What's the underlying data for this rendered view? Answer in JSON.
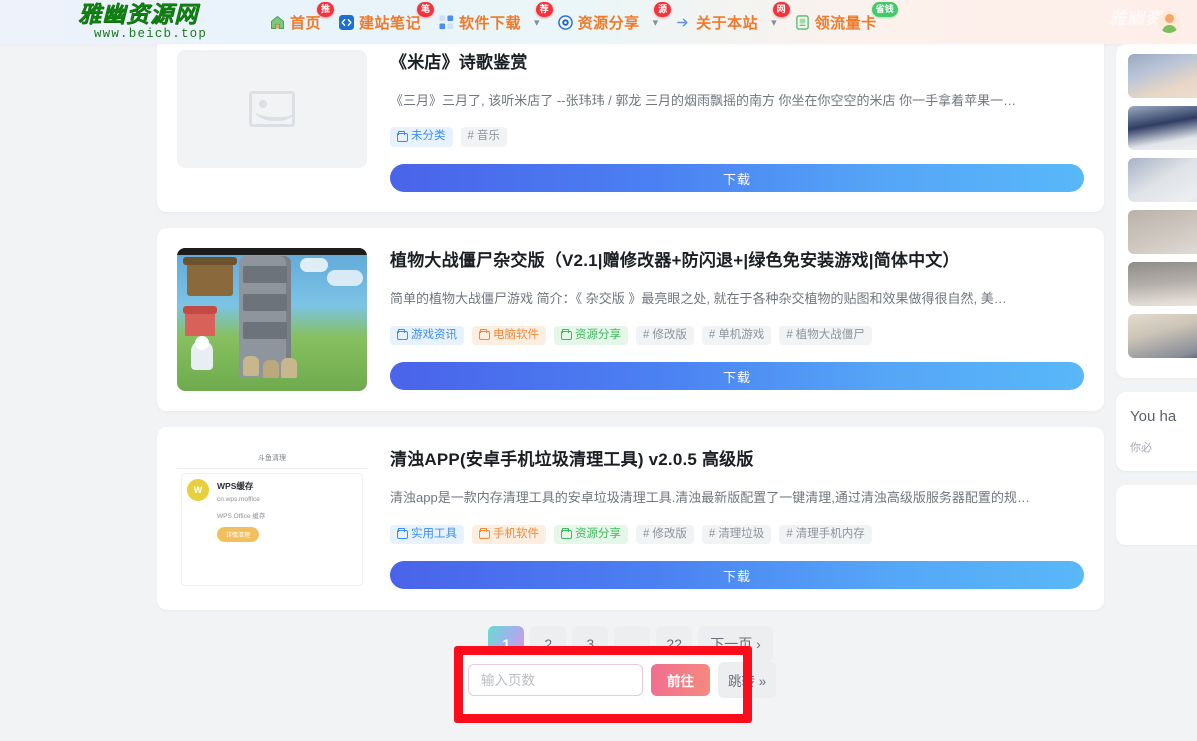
{
  "site": {
    "logo_cn": "雅幽资源网",
    "logo_url": "www.beicb.top"
  },
  "nav": {
    "items": [
      {
        "label": "首页",
        "icon": "home-icon",
        "badge": "推",
        "badge_color": "red",
        "has_caret": false
      },
      {
        "label": "建站笔记",
        "icon": "code-icon",
        "badge": "笔",
        "badge_color": "red",
        "has_caret": false
      },
      {
        "label": "软件下载",
        "icon": "apps-icon",
        "badge": "荐",
        "badge_color": "red",
        "has_caret": true
      },
      {
        "label": "资源分享",
        "icon": "target-icon",
        "badge": "源",
        "badge_color": "red",
        "has_caret": true
      },
      {
        "label": "关于本站",
        "icon": "info-icon",
        "badge": "网",
        "badge_color": "red",
        "has_caret": true
      },
      {
        "label": "领流量卡",
        "icon": "simcard-icon",
        "badge": "省钱",
        "badge_color": "green",
        "has_caret": false
      }
    ],
    "watermark": "雅幽资"
  },
  "posts": [
    {
      "title": "《米店》诗歌鉴赏",
      "excerpt": "《三月》三月了, 该听米店了 --张玮玮 / 郭龙 三月的烟雨飘摇的南方 你坐在你空空的米店 你一手拿着苹果一…",
      "thumb_type": "placeholder",
      "categories": [
        {
          "label": "未分类",
          "color": "blue"
        }
      ],
      "tags": [
        "音乐"
      ],
      "download_label": "下载"
    },
    {
      "title": "植物大战僵尸杂交版（V2.1|赠修改器+防闪退+|绿色免安装游戏|简体中文）",
      "excerpt": "简单的植物大战僵尸游戏 简介：《 杂交版 》最亮眼之处, 就在于各种杂交植物的贴图和效果做得很自然, 美…",
      "thumb_type": "pvz",
      "categories": [
        {
          "label": "游戏资讯",
          "color": "blue"
        },
        {
          "label": "电脑软件",
          "color": "orange"
        },
        {
          "label": "资源分享",
          "color": "green"
        }
      ],
      "tags": [
        "修改版",
        "单机游戏",
        "植物大战僵尸"
      ],
      "download_label": "下载"
    },
    {
      "title": "清浊APP(安卓手机垃圾清理工具) v2.0.5 高级版",
      "excerpt": "清浊app是一款内存清理工具的安卓垃圾清理工具.清浊最新版配置了一键清理,通过清浊高级版服务器配置的规…",
      "thumb_type": "wps",
      "thumb_texts": {
        "header": "斗鱼清理",
        "app_name": "WPS缓存",
        "app_pkg": "cn.wps.moffice",
        "app_desc": "WPS Office 缓存",
        "app_btn": "详情清理",
        "avatar_letter": "W"
      },
      "categories": [
        {
          "label": "实用工具",
          "color": "blue"
        },
        {
          "label": "手机软件",
          "color": "orange"
        },
        {
          "label": "资源分享",
          "color": "green"
        }
      ],
      "tags": [
        "修改版",
        "清理垃圾",
        "清理手机内存"
      ],
      "download_label": "下载"
    }
  ],
  "pagination": {
    "pages": [
      "1",
      "2",
      "3",
      "…",
      "22"
    ],
    "active_page": "1",
    "next_label": "下一页 ›",
    "jump_placeholder": "输入页数",
    "jump_value": "",
    "go_label": "前往",
    "skip_label": "跳转 »"
  },
  "sidebar": {
    "gallery_thumb_count": 6,
    "notice_en": "You ha",
    "notice_cn": "你必"
  },
  "colors": {
    "nav_text": "#f07a2a",
    "logo_green": "#118012",
    "badge_red": "#f4343d",
    "badge_green": "#43c96a",
    "download_gradient_start": "#4a63ea",
    "download_gradient_end": "#59b8f8",
    "active_page_gradient": "#67dbd0 → #e48ee6",
    "go_button_gradient": "#f16d91 → #f58a7e",
    "highlight_box": "#fc0d1b"
  }
}
